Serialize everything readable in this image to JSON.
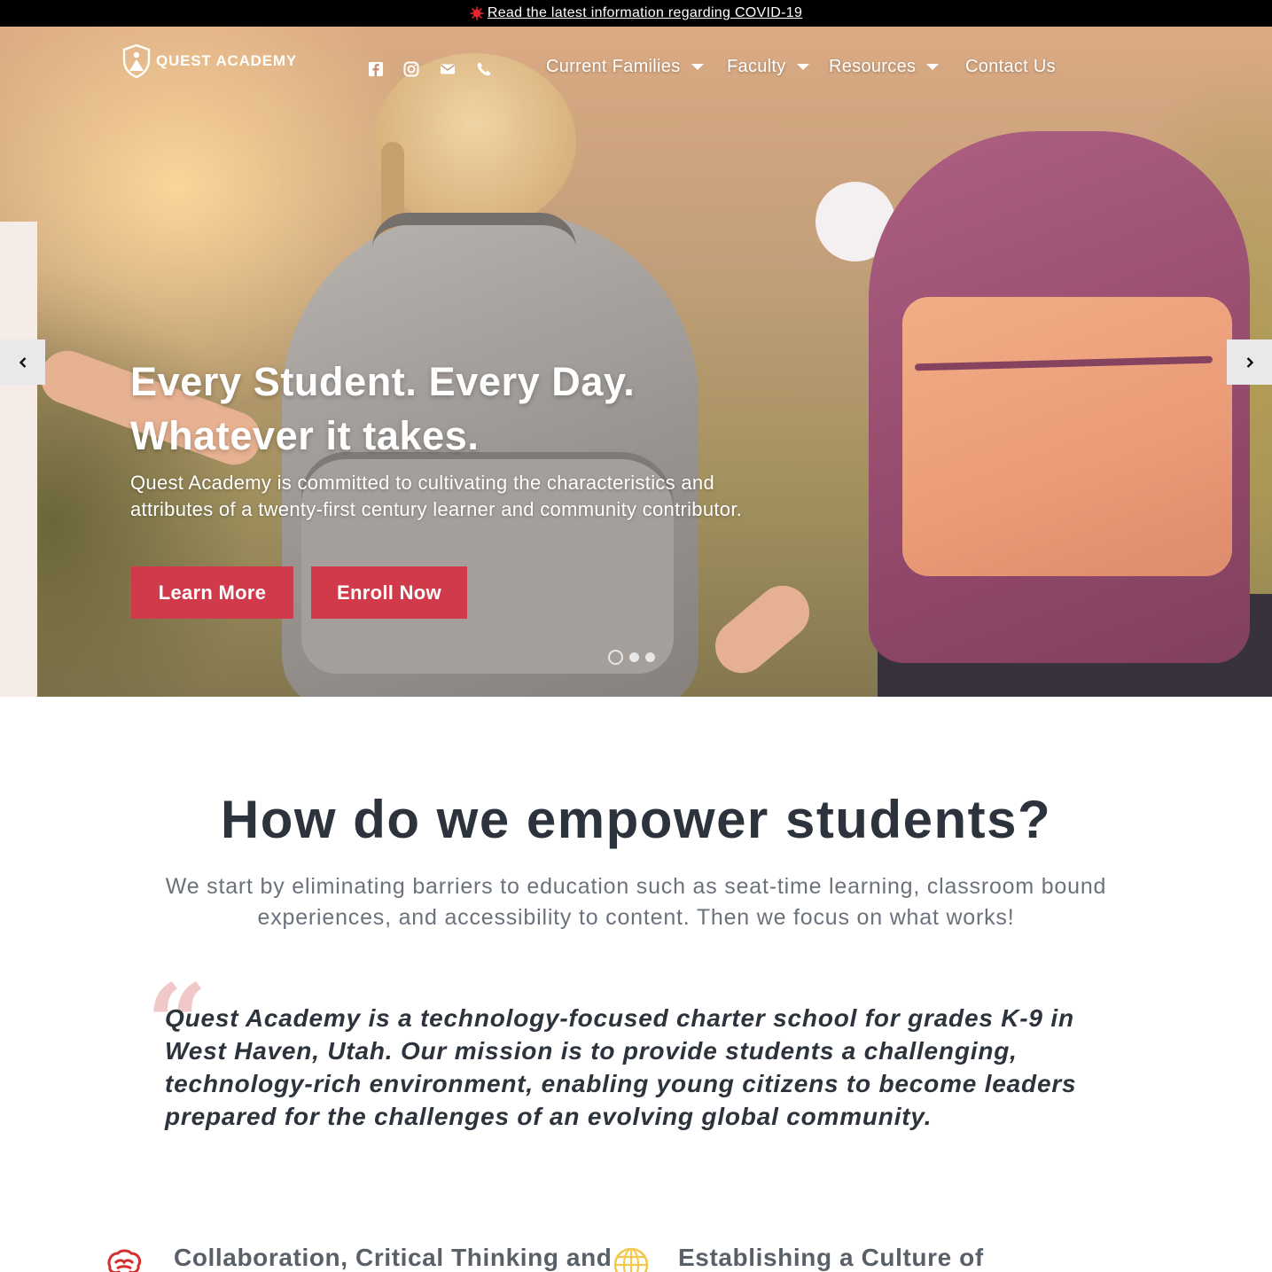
{
  "alert": {
    "text": "Read the latest information regarding COVID-19",
    "icon": "virus-icon"
  },
  "header": {
    "logo_text": "QUEST ACADEMY",
    "social": [
      {
        "name": "facebook-icon"
      },
      {
        "name": "instagram-icon"
      },
      {
        "name": "envelope-icon"
      },
      {
        "name": "phone-icon"
      }
    ],
    "nav": {
      "current_families": "Current Families",
      "faculty": "Faculty",
      "resources": "Resources",
      "contact_us": "Contact Us"
    }
  },
  "hero": {
    "title_line1": "Every Student. Every Day.",
    "title_line2": "Whatever it takes.",
    "description": "Quest Academy is committed to cultivating the characteristics and attributes of a twenty-first century learner and community contributor.",
    "learn_more": "Learn More",
    "enroll_now": "Enroll Now",
    "slides": {
      "count": 3,
      "active": 1
    }
  },
  "main": {
    "title": "How do we empower students?",
    "subtitle": "We start by eliminating barriers to education such as seat-time learning, classroom bound experiences, and accessibility to content. Then we focus on what works!",
    "quote_mark": "“",
    "quote": "Quest Academy is a technology-focused charter school for grades K-9 in West Haven, Utah. Our mission is to provide students a challenging, technology-rich environment, enabling young citizens to become leaders prepared for the challenges of an evolving global community.",
    "features": [
      {
        "icon": "brain-icon",
        "title": "Collaboration, Critical Thinking and"
      },
      {
        "icon": "globe-icon",
        "title": "Establishing a Culture of"
      }
    ]
  },
  "colors": {
    "accent": "#d03a4b",
    "heading": "#2c333c",
    "body_text": "#6b727b",
    "quote_mark": "#f0c8c8",
    "globe": "#f2c94c",
    "alert_bg": "#000000"
  }
}
